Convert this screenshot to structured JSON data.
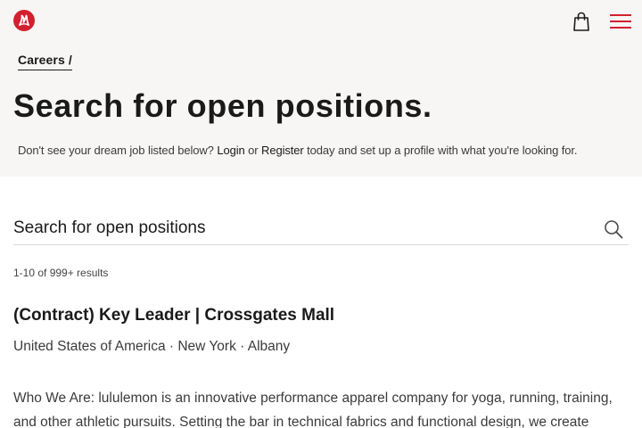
{
  "header": {
    "logo_icon": "lululemon-logo-icon",
    "cart_icon": "shopping-bag-icon",
    "menu_icon": "hamburger-menu-icon",
    "brand_color": "#d22030"
  },
  "breadcrumb": {
    "label": "Careers",
    "separator": "/"
  },
  "page": {
    "title": "Search for open positions.",
    "subtitle_prefix": "Don't see your dream job listed below?",
    "login_link": "Login",
    "or_text": "or",
    "register_link": "Register",
    "subtitle_suffix": "today and set up a profile with what you're looking for."
  },
  "search": {
    "placeholder": "Search for open positions",
    "value": "",
    "icon": "search-icon"
  },
  "results": {
    "count_text": "1-10 of 999+ results",
    "jobs": [
      {
        "title": "(Contract) Key Leader | Crossgates Mall",
        "location": "United States of America · New York · Albany",
        "description": "Who We Are: lululemon is an innovative performance apparel company for yoga, running, training, and other athletic pursuits. Setting the bar in technical fabrics and functional design, we create"
      }
    ]
  }
}
